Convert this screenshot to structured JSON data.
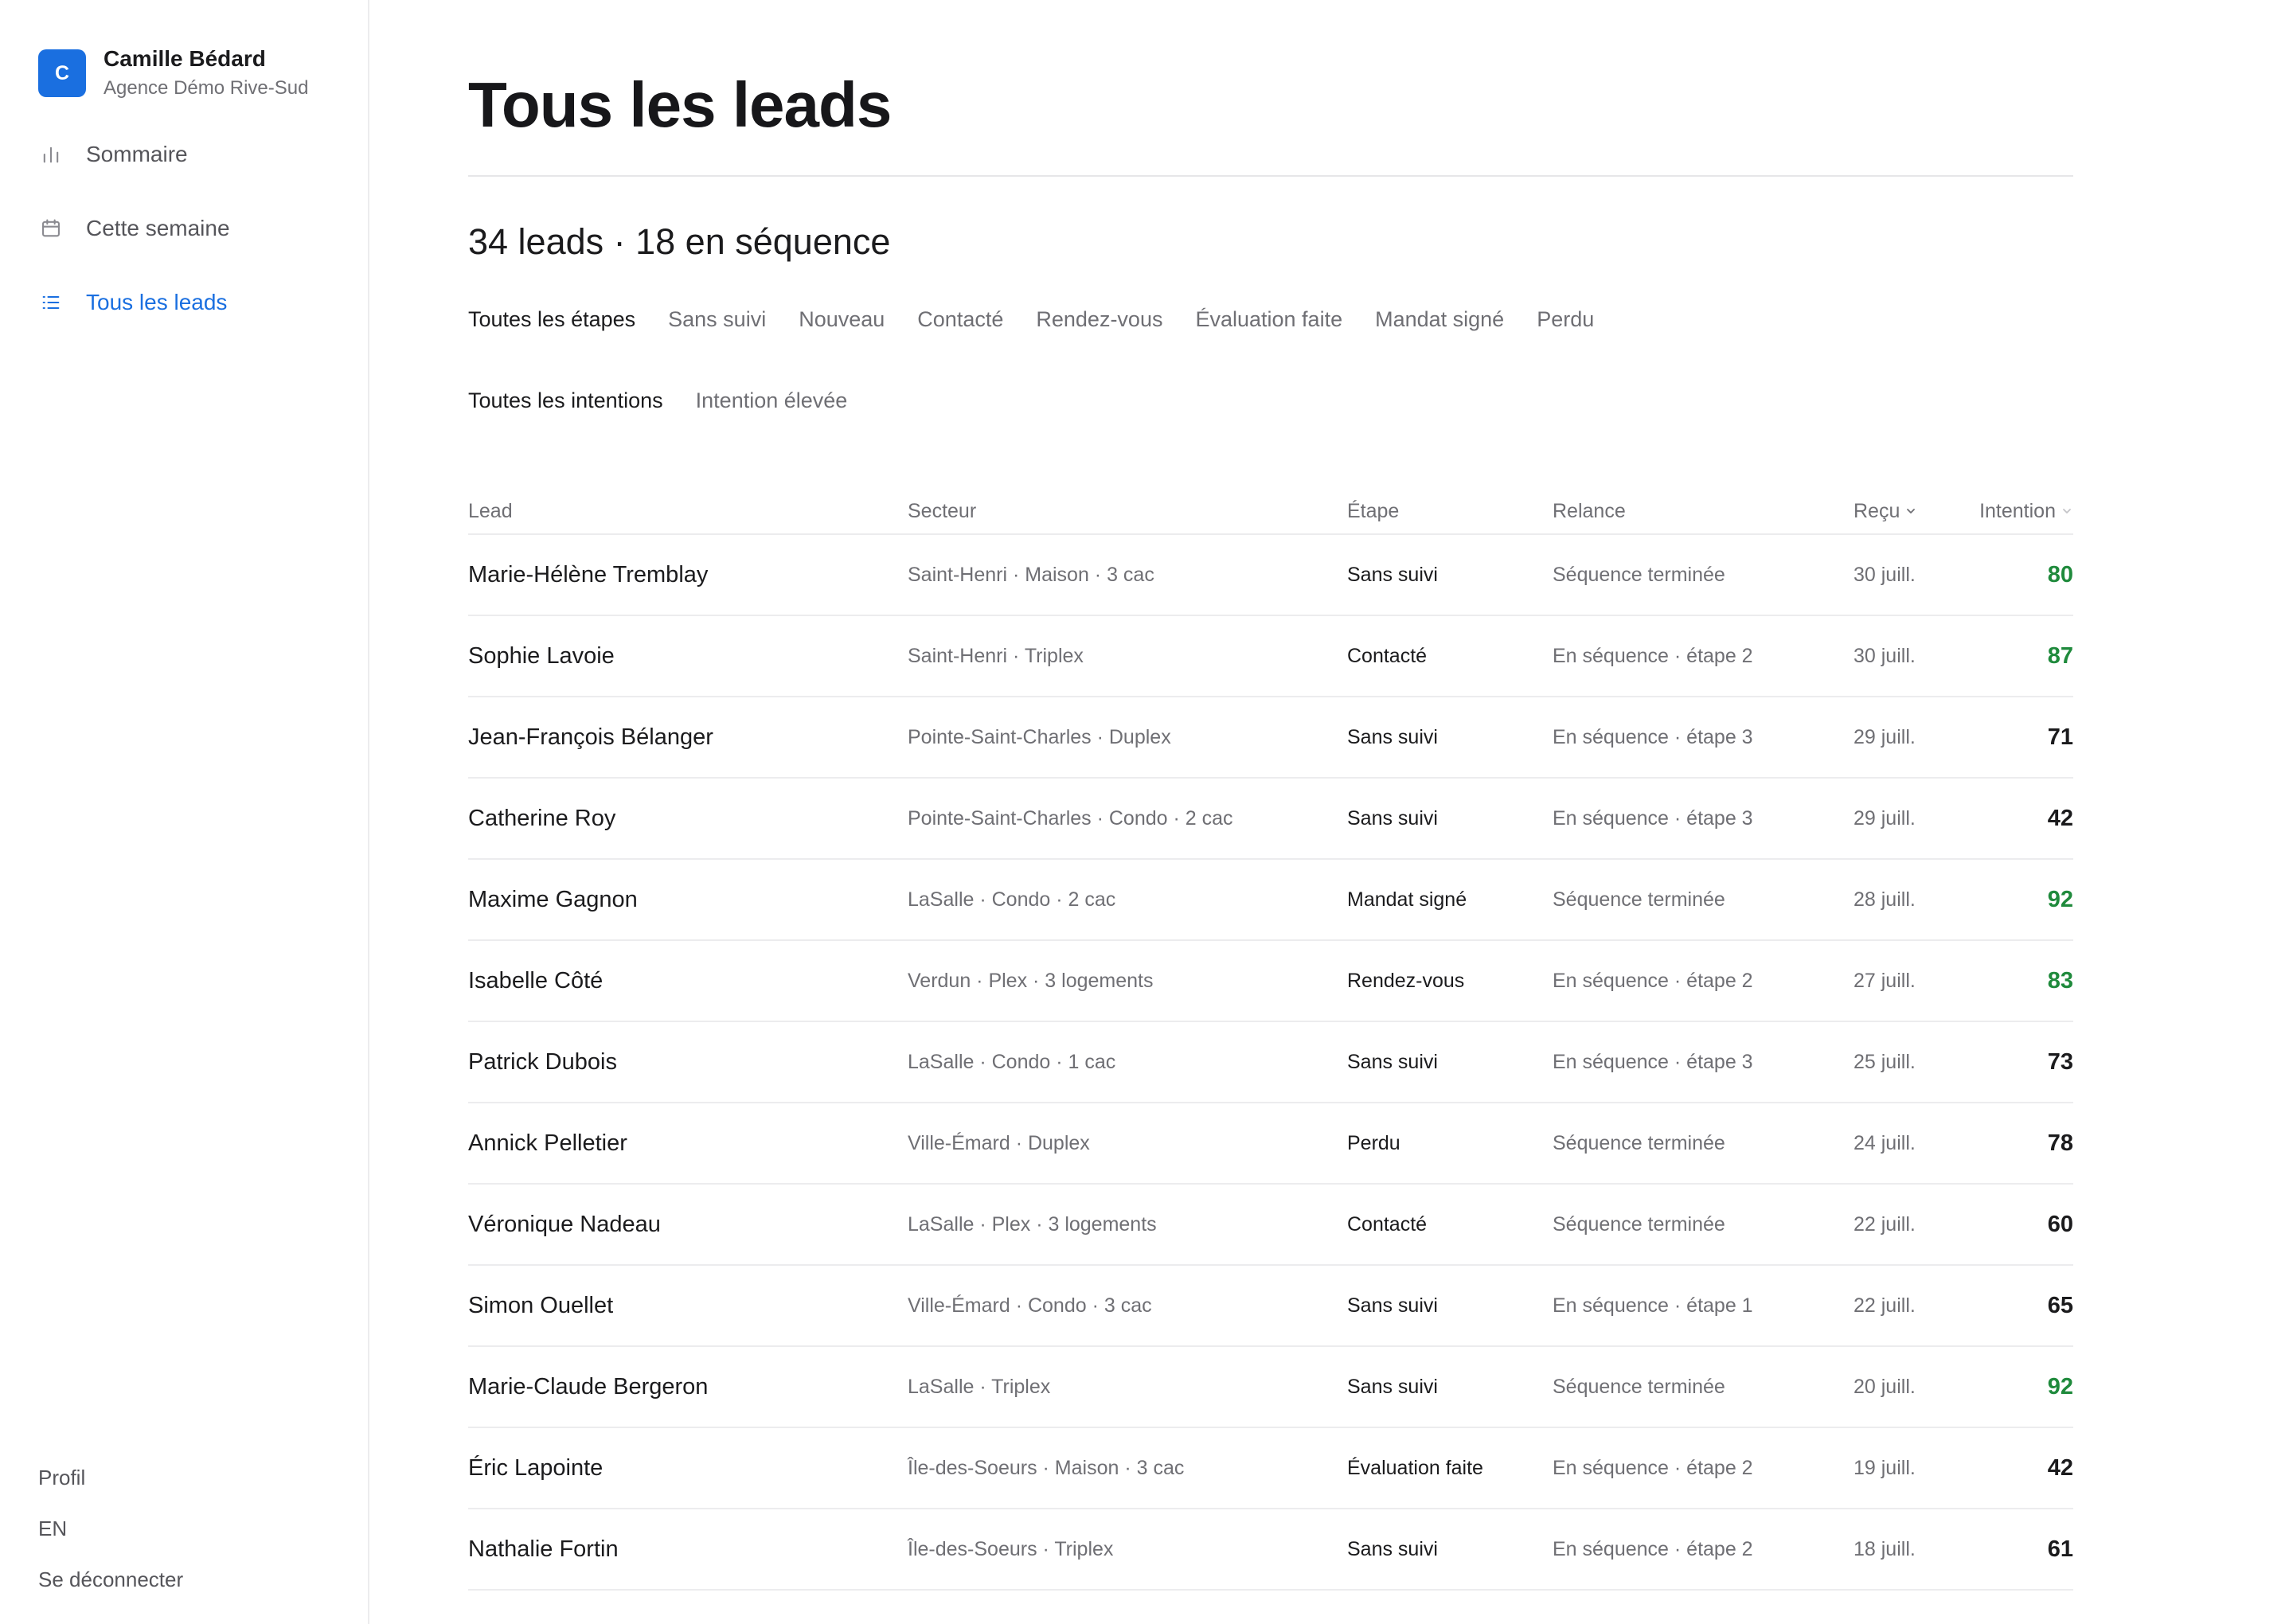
{
  "account": {
    "avatar_letter": "C",
    "name": "Camille Bédard",
    "org": "Agence Démo Rive-Sud"
  },
  "nav": {
    "items": [
      {
        "label": "Sommaire",
        "icon": "bar-chart-icon",
        "active": false
      },
      {
        "label": "Cette semaine",
        "icon": "calendar-icon",
        "active": false
      },
      {
        "label": "Tous les leads",
        "icon": "list-icon",
        "active": true
      }
    ]
  },
  "footer": {
    "profile": "Profil",
    "language": "EN",
    "logout": "Se déconnecter"
  },
  "page": {
    "title": "Tous les leads",
    "summary": "34 leads · 18 en séquence"
  },
  "filters": {
    "stages": [
      "Toutes les étapes",
      "Sans suivi",
      "Nouveau",
      "Contacté",
      "Rendez-vous",
      "Évaluation faite",
      "Mandat signé",
      "Perdu"
    ],
    "stage_active": 0,
    "intents": [
      "Toutes les intentions",
      "Intention élevée"
    ],
    "intent_active": 0
  },
  "colors": {
    "accent": "#1a6fe0",
    "high_intent": "#1f8a3c"
  },
  "table": {
    "headers": {
      "lead": "Lead",
      "sector": "Secteur",
      "stage": "Étape",
      "followup": "Relance",
      "received": "Reçu",
      "intent": "Intention"
    },
    "rows": [
      {
        "lead": "Marie-Hélène Tremblay",
        "sector": "Saint-Henri · Maison · 3 cac",
        "stage": "Sans suivi",
        "followup": "Séquence terminée",
        "received": "30 juill.",
        "intent": "80",
        "high": true
      },
      {
        "lead": "Sophie Lavoie",
        "sector": "Saint-Henri · Triplex",
        "stage": "Contacté",
        "followup": "En séquence · étape 2",
        "received": "30 juill.",
        "intent": "87",
        "high": true
      },
      {
        "lead": "Jean-François Bélanger",
        "sector": "Pointe-Saint-Charles · Duplex",
        "stage": "Sans suivi",
        "followup": "En séquence · étape 3",
        "received": "29 juill.",
        "intent": "71",
        "high": false
      },
      {
        "lead": "Catherine Roy",
        "sector": "Pointe-Saint-Charles · Condo · 2 cac",
        "stage": "Sans suivi",
        "followup": "En séquence · étape 3",
        "received": "29 juill.",
        "intent": "42",
        "high": false
      },
      {
        "lead": "Maxime Gagnon",
        "sector": "LaSalle · Condo · 2 cac",
        "stage": "Mandat signé",
        "followup": "Séquence terminée",
        "received": "28 juill.",
        "intent": "92",
        "high": true
      },
      {
        "lead": "Isabelle Côté",
        "sector": "Verdun · Plex · 3 logements",
        "stage": "Rendez-vous",
        "followup": "En séquence · étape 2",
        "received": "27 juill.",
        "intent": "83",
        "high": true
      },
      {
        "lead": "Patrick Dubois",
        "sector": "LaSalle · Condo · 1 cac",
        "stage": "Sans suivi",
        "followup": "En séquence · étape 3",
        "received": "25 juill.",
        "intent": "73",
        "high": false
      },
      {
        "lead": "Annick Pelletier",
        "sector": "Ville-Émard · Duplex",
        "stage": "Perdu",
        "followup": "Séquence terminée",
        "received": "24 juill.",
        "intent": "78",
        "high": false
      },
      {
        "lead": "Véronique Nadeau",
        "sector": "LaSalle · Plex · 3 logements",
        "stage": "Contacté",
        "followup": "Séquence terminée",
        "received": "22 juill.",
        "intent": "60",
        "high": false
      },
      {
        "lead": "Simon Ouellet",
        "sector": "Ville-Émard · Condo · 3 cac",
        "stage": "Sans suivi",
        "followup": "En séquence · étape 1",
        "received": "22 juill.",
        "intent": "65",
        "high": false
      },
      {
        "lead": "Marie-Claude Bergeron",
        "sector": "LaSalle · Triplex",
        "stage": "Sans suivi",
        "followup": "Séquence terminée",
        "received": "20 juill.",
        "intent": "92",
        "high": true
      },
      {
        "lead": "Éric Lapointe",
        "sector": "Île-des-Soeurs · Maison · 3 cac",
        "stage": "Évaluation faite",
        "followup": "En séquence · étape 2",
        "received": "19 juill.",
        "intent": "42",
        "high": false
      },
      {
        "lead": "Nathalie Fortin",
        "sector": "Île-des-Soeurs · Triplex",
        "stage": "Sans suivi",
        "followup": "En séquence · étape 2",
        "received": "18 juill.",
        "intent": "61",
        "high": false
      }
    ]
  }
}
